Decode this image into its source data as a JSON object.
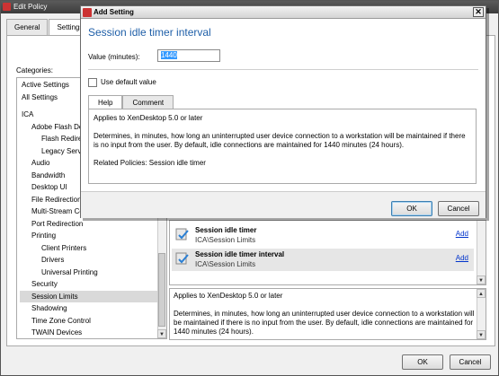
{
  "back_window": {
    "title": "Edit Policy",
    "tabs": [
      "General",
      "Settings"
    ],
    "categories_label": "Categories:",
    "categories": {
      "top": [
        "Active Settings",
        "All Settings"
      ],
      "items": [
        {
          "label": "ICA",
          "indent": 0
        },
        {
          "label": "Adobe Flash Delivery",
          "indent": 1
        },
        {
          "label": "Flash Redirection",
          "indent": 2
        },
        {
          "label": "Legacy Server Side Optimizations",
          "indent": 2
        },
        {
          "label": "Audio",
          "indent": 1
        },
        {
          "label": "Bandwidth",
          "indent": 1
        },
        {
          "label": "Desktop UI",
          "indent": 1
        },
        {
          "label": "File Redirection",
          "indent": 1
        },
        {
          "label": "Multi-Stream Connections",
          "indent": 1
        },
        {
          "label": "Port Redirection",
          "indent": 1
        },
        {
          "label": "Printing",
          "indent": 1
        },
        {
          "label": "Client Printers",
          "indent": 2
        },
        {
          "label": "Drivers",
          "indent": 2
        },
        {
          "label": "Universal Printing",
          "indent": 2
        },
        {
          "label": "Security",
          "indent": 1
        },
        {
          "label": "Session Limits",
          "indent": 1,
          "selected": true
        },
        {
          "label": "Shadowing",
          "indent": 1
        },
        {
          "label": "Time Zone Control",
          "indent": 1
        },
        {
          "label": "TWAIN Devices",
          "indent": 1
        }
      ]
    },
    "settings": [
      {
        "name": "Session idle timer",
        "path": "ICA\\Session Limits",
        "action": "Add"
      },
      {
        "name": "Session idle timer interval",
        "path": "ICA\\Session Limits",
        "action": "Add",
        "selected": true
      }
    ],
    "description": {
      "applies": "Applies to XenDesktop 5.0 or later",
      "body": "Determines, in minutes, how long an uninterrupted user device connection to a workstation will be maintained if there is no input from the user. By default, idle connections are maintained for 1440 minutes (24 hours)."
    },
    "buttons": {
      "ok": "OK",
      "cancel": "Cancel"
    }
  },
  "dialog": {
    "title": "Add Setting",
    "close_glyph": "✕",
    "heading": "Session idle timer interval",
    "value_label": "Value (minutes):",
    "value": "1440",
    "use_default_label": "Use default value",
    "tabs": [
      "Help",
      "Comment"
    ],
    "help": {
      "applies": "Applies to XenDesktop 5.0 or later",
      "body": "Determines, in minutes, how long an uninterrupted user device connection to a workstation will be maintained if there is no input from the user. By default, idle connections are maintained for 1440 minutes (24 hours).",
      "related": "Related Policies: Session idle timer"
    },
    "buttons": {
      "ok": "OK",
      "cancel": "Cancel"
    }
  },
  "colors": {
    "heading": "#1f5fa8",
    "link": "#0033cc",
    "selection": "#3399ff"
  }
}
